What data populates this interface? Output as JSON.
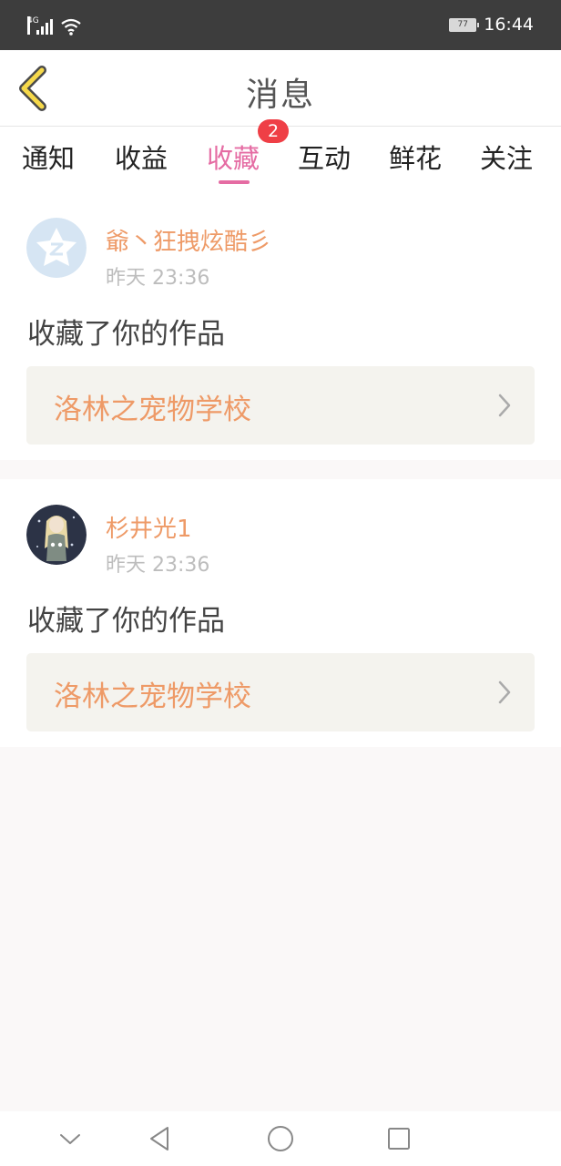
{
  "status_bar": {
    "network": "4G",
    "battery": "77",
    "time": "16:44"
  },
  "header": {
    "title": "消息"
  },
  "tabs": [
    {
      "label": "通知"
    },
    {
      "label": "收益"
    },
    {
      "label": "收藏",
      "active": true,
      "badge": "2"
    },
    {
      "label": "互动"
    },
    {
      "label": "鲜花"
    },
    {
      "label": "关注"
    }
  ],
  "messages": [
    {
      "username": "爺丶狂拽炫酷彡",
      "time": "昨天 23:36",
      "action": "收藏了你的作品",
      "work_title": "洛林之宠物学校"
    },
    {
      "username": "杉井光1",
      "time": "昨天 23:36",
      "action": "收藏了你的作品",
      "work_title": "洛林之宠物学校"
    }
  ],
  "colors": {
    "accent_pink": "#e56ca3",
    "username_orange": "#ee9a67",
    "badge_red": "#ef3f46",
    "back_arrow_yellow": "#f6d94a"
  },
  "icons": {
    "back": "back-arrow-icon",
    "chevron": "chevron-right-icon",
    "nav": [
      "nav-down-icon",
      "nav-back-icon",
      "nav-home-icon",
      "nav-recents-icon"
    ]
  }
}
